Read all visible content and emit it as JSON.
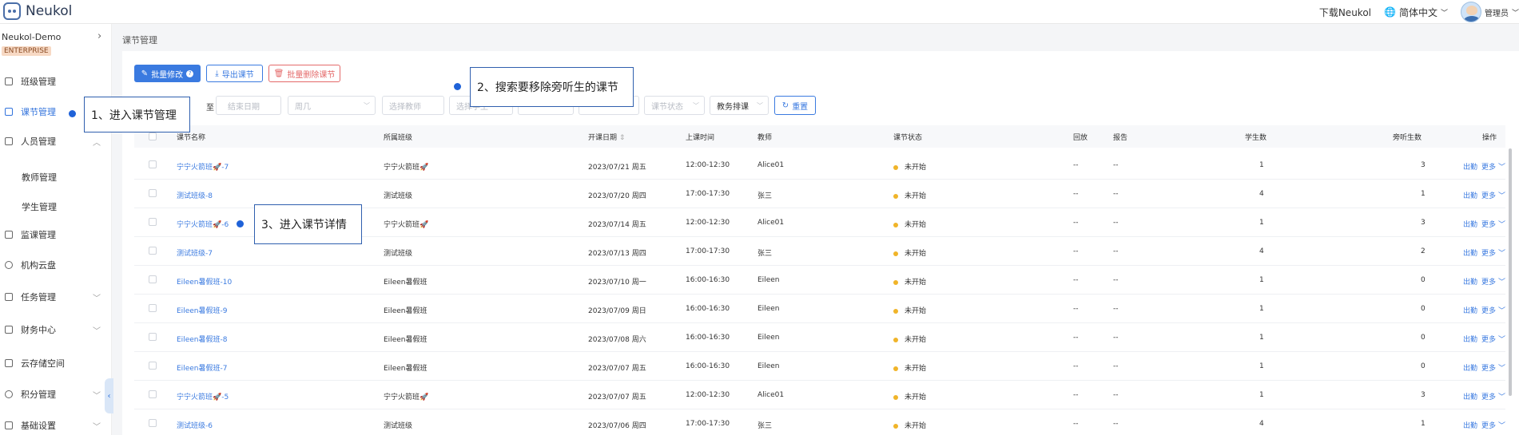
{
  "app": {
    "logo": "Neukol"
  },
  "topbar": {
    "download": "下载Neukol",
    "language": "简体中文",
    "user": "管理员"
  },
  "sidebar": {
    "org": "Neukol-Demo",
    "edition": "ENTERPRISE",
    "items": [
      {
        "label": "班级管理",
        "active": false,
        "expandable": false
      },
      {
        "label": "课节管理",
        "active": true,
        "expandable": false
      },
      {
        "label": "人员管理",
        "active": false,
        "expandable": true
      },
      {
        "label": "教师管理",
        "sub": true
      },
      {
        "label": "学生管理",
        "sub": true
      },
      {
        "label": "监课管理",
        "active": false,
        "expandable": false
      },
      {
        "label": "机构云盘",
        "active": false,
        "expandable": false
      },
      {
        "label": "任务管理",
        "active": false,
        "expandable": true
      },
      {
        "label": "财务中心",
        "active": false,
        "expandable": true
      },
      {
        "label": "云存储空间",
        "active": false,
        "expandable": false
      },
      {
        "label": "积分管理",
        "active": false,
        "expandable": true
      },
      {
        "label": "基础设置",
        "active": false,
        "expandable": true
      }
    ]
  },
  "breadcrumb": "课节管理",
  "toolbar": {
    "batch_edit": "批量修改",
    "export": "导出课节",
    "batch_delete": "批量删除课节"
  },
  "filters": {
    "to_label": "至",
    "end_date": "结束日期",
    "weekday": "周几",
    "teacher": "选择教师",
    "student": "选择学生",
    "class_status": "课节状态",
    "arrange": "教务排课",
    "reset": "重置"
  },
  "table": {
    "headers": [
      "课节名称",
      "所属班级",
      "开课日期",
      "上课时间",
      "教师",
      "课节状态",
      "回放",
      "报告",
      "学生数",
      "旁听生数",
      "操作"
    ],
    "rows": [
      {
        "name": "宁宁火箭班🚀-7",
        "class": "宁宁火箭班🚀",
        "date": "2023/07/21 周五",
        "time": "12:00-12:30",
        "teacher": "Alice01",
        "status": "未开始",
        "replay": "--",
        "report": "--",
        "students": "1",
        "auditors": "3"
      },
      {
        "name": "测试班级-8",
        "class": "测试班级",
        "date": "2023/07/20 周四",
        "time": "17:00-17:30",
        "teacher": "张三",
        "status": "未开始",
        "replay": "--",
        "report": "--",
        "students": "4",
        "auditors": "1"
      },
      {
        "name": "宁宁火箭班🚀-6",
        "class": "宁宁火箭班🚀",
        "date": "2023/07/14 周五",
        "time": "12:00-12:30",
        "teacher": "Alice01",
        "status": "未开始",
        "replay": "--",
        "report": "--",
        "students": "1",
        "auditors": "3"
      },
      {
        "name": "测试班级-7",
        "class": "测试班级",
        "date": "2023/07/13 周四",
        "time": "17:00-17:30",
        "teacher": "张三",
        "status": "未开始",
        "replay": "--",
        "report": "--",
        "students": "4",
        "auditors": "2"
      },
      {
        "name": "Eileen暑假班-10",
        "class": "Eileen暑假班",
        "date": "2023/07/10 周一",
        "time": "16:00-16:30",
        "teacher": "Eileen",
        "status": "未开始",
        "replay": "--",
        "report": "--",
        "students": "1",
        "auditors": "0"
      },
      {
        "name": "Eileen暑假班-9",
        "class": "Eileen暑假班",
        "date": "2023/07/09 周日",
        "time": "16:00-16:30",
        "teacher": "Eileen",
        "status": "未开始",
        "replay": "--",
        "report": "--",
        "students": "1",
        "auditors": "0"
      },
      {
        "name": "Eileen暑假班-8",
        "class": "Eileen暑假班",
        "date": "2023/07/08 周六",
        "time": "16:00-16:30",
        "teacher": "Eileen",
        "status": "未开始",
        "replay": "--",
        "report": "--",
        "students": "1",
        "auditors": "0"
      },
      {
        "name": "Eileen暑假班-7",
        "class": "Eileen暑假班",
        "date": "2023/07/07 周五",
        "time": "16:00-16:30",
        "teacher": "Eileen",
        "status": "未开始",
        "replay": "--",
        "report": "--",
        "students": "1",
        "auditors": "0"
      },
      {
        "name": "宁宁火箭班🚀-5",
        "class": "宁宁火箭班🚀",
        "date": "2023/07/07 周五",
        "time": "12:00-12:30",
        "teacher": "Alice01",
        "status": "未开始",
        "replay": "--",
        "report": "--",
        "students": "1",
        "auditors": "3"
      },
      {
        "name": "测试班级-6",
        "class": "测试班级",
        "date": "2023/07/06 周四",
        "time": "17:00-17:30",
        "teacher": "张三",
        "status": "未开始",
        "replay": "--",
        "report": "--",
        "students": "4",
        "auditors": "1"
      }
    ],
    "action_checkin": "出勤",
    "action_more": "更多"
  },
  "annotations": {
    "step1": "1、进入课节管理",
    "step2": "2、搜索要移除旁听生的课节",
    "step3": "3、进入课节详情"
  },
  "colors": {
    "primary": "#3a7ae0",
    "danger": "#e46a6a",
    "status_pending": "#f0b429",
    "annotation": "#1f62d8"
  }
}
